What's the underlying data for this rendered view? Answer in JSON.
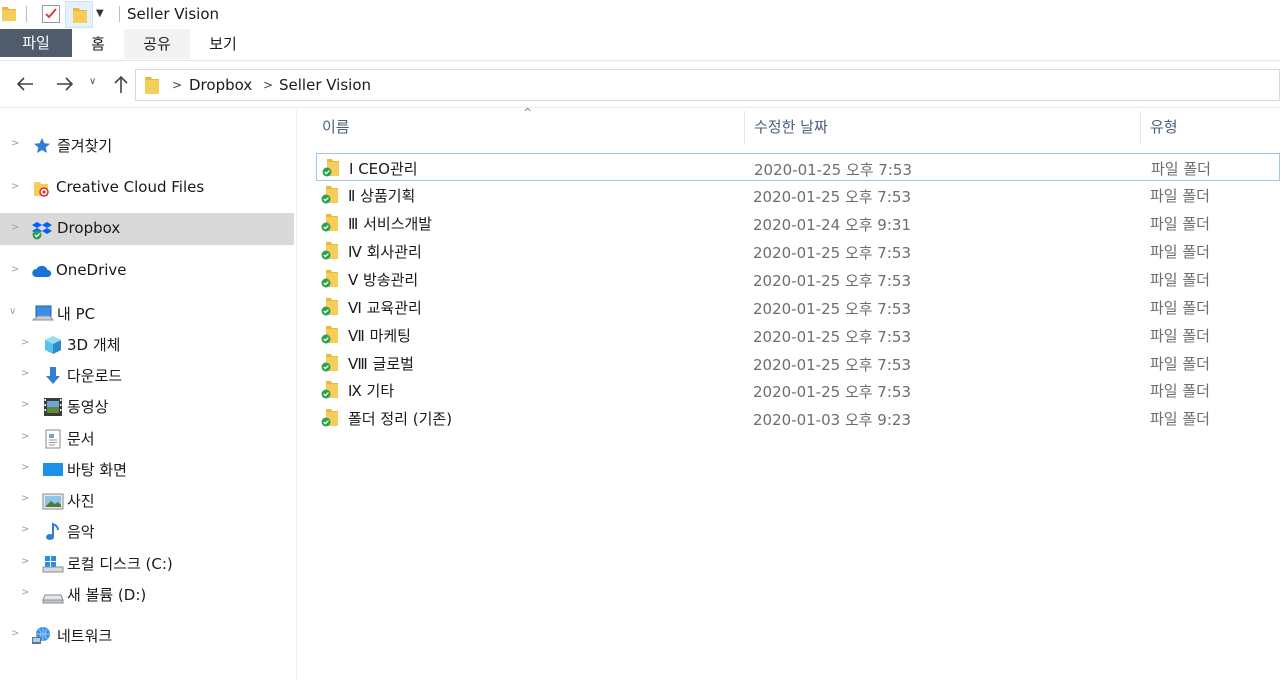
{
  "window": {
    "title": "Seller Vision"
  },
  "ribbon": {
    "tabs": [
      "파일",
      "홈",
      "공유",
      "보기"
    ]
  },
  "address": {
    "crumbs": [
      "Dropbox",
      "Seller Vision"
    ]
  },
  "sidebar": {
    "items": [
      {
        "label": "즐겨찾기",
        "icon": "star-icon"
      },
      {
        "label": "Creative Cloud Files",
        "icon": "creative-cloud-folder-icon"
      },
      {
        "label": "Dropbox",
        "icon": "dropbox-icon",
        "selected": true
      },
      {
        "label": "OneDrive",
        "icon": "onedrive-cloud-icon"
      },
      {
        "label": "내 PC",
        "icon": "pc-icon",
        "expanded": true
      },
      {
        "label": "3D 개체",
        "icon": "3d-objects-icon"
      },
      {
        "label": "다운로드",
        "icon": "download-icon"
      },
      {
        "label": "동영상",
        "icon": "video-icon"
      },
      {
        "label": "문서",
        "icon": "document-icon"
      },
      {
        "label": "바탕 화면",
        "icon": "desktop-icon"
      },
      {
        "label": "사진",
        "icon": "pictures-icon"
      },
      {
        "label": "음악",
        "icon": "music-icon"
      },
      {
        "label": "로컬 디스크 (C:)",
        "icon": "windows-drive-icon"
      },
      {
        "label": "새 볼륨 (D:)",
        "icon": "drive-icon"
      },
      {
        "label": "네트워크",
        "icon": "network-icon"
      }
    ]
  },
  "columns": {
    "name": "이름",
    "date": "수정한 날짜",
    "type": "유형"
  },
  "files": [
    {
      "name": "Ⅰ  CEO관리",
      "date": "2020-01-25 오후 7:53",
      "type": "파일 폴더"
    },
    {
      "name": "Ⅱ  상품기획",
      "date": "2020-01-25 오후 7:53",
      "type": "파일 폴더"
    },
    {
      "name": "Ⅲ  서비스개발",
      "date": "2020-01-24 오후 9:31",
      "type": "파일 폴더"
    },
    {
      "name": "Ⅳ  회사관리",
      "date": "2020-01-25 오후 7:53",
      "type": "파일 폴더"
    },
    {
      "name": "Ⅴ  방송관리",
      "date": "2020-01-25 오후 7:53",
      "type": "파일 폴더"
    },
    {
      "name": "Ⅵ  교육관리",
      "date": "2020-01-25 오후 7:53",
      "type": "파일 폴더"
    },
    {
      "name": "Ⅶ  마케팅",
      "date": "2020-01-25 오후 7:53",
      "type": "파일 폴더"
    },
    {
      "name": "Ⅷ  글로벌",
      "date": "2020-01-25 오후 7:53",
      "type": "파일 폴더"
    },
    {
      "name": "Ⅸ  기타",
      "date": "2020-01-25 오후 7:53",
      "type": "파일 폴더"
    },
    {
      "name": "폴더 정리 (기존)",
      "date": "2020-01-03 오후 9:23",
      "type": "파일 폴더"
    }
  ],
  "colors": {
    "file_tab": "#505b6b",
    "selection": "#d9d9d9",
    "sync_ok": "#2da14b",
    "folder": "#f0c350"
  }
}
